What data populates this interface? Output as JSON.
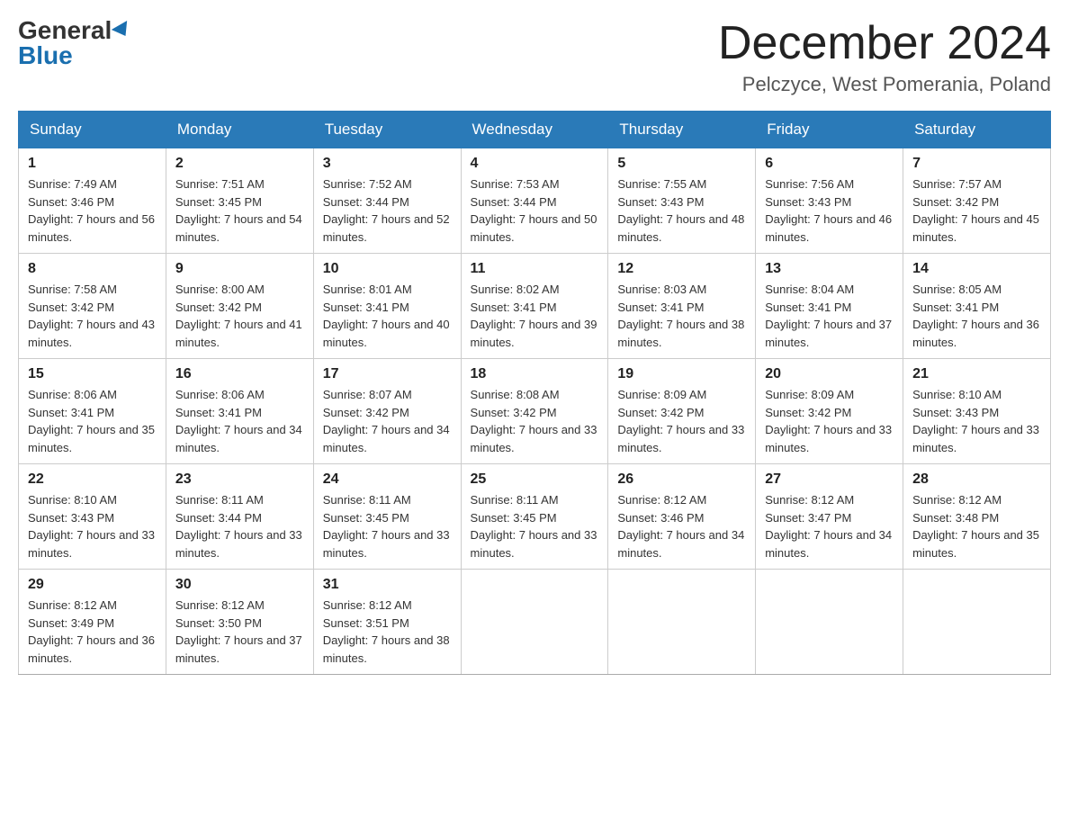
{
  "header": {
    "logo_general": "General",
    "logo_blue": "Blue",
    "month_title": "December 2024",
    "location": "Pelczyce, West Pomerania, Poland"
  },
  "weekdays": [
    "Sunday",
    "Monday",
    "Tuesday",
    "Wednesday",
    "Thursday",
    "Friday",
    "Saturday"
  ],
  "weeks": [
    [
      {
        "day": "1",
        "sunrise": "7:49 AM",
        "sunset": "3:46 PM",
        "daylight": "7 hours and 56 minutes."
      },
      {
        "day": "2",
        "sunrise": "7:51 AM",
        "sunset": "3:45 PM",
        "daylight": "7 hours and 54 minutes."
      },
      {
        "day": "3",
        "sunrise": "7:52 AM",
        "sunset": "3:44 PM",
        "daylight": "7 hours and 52 minutes."
      },
      {
        "day": "4",
        "sunrise": "7:53 AM",
        "sunset": "3:44 PM",
        "daylight": "7 hours and 50 minutes."
      },
      {
        "day": "5",
        "sunrise": "7:55 AM",
        "sunset": "3:43 PM",
        "daylight": "7 hours and 48 minutes."
      },
      {
        "day": "6",
        "sunrise": "7:56 AM",
        "sunset": "3:43 PM",
        "daylight": "7 hours and 46 minutes."
      },
      {
        "day": "7",
        "sunrise": "7:57 AM",
        "sunset": "3:42 PM",
        "daylight": "7 hours and 45 minutes."
      }
    ],
    [
      {
        "day": "8",
        "sunrise": "7:58 AM",
        "sunset": "3:42 PM",
        "daylight": "7 hours and 43 minutes."
      },
      {
        "day": "9",
        "sunrise": "8:00 AM",
        "sunset": "3:42 PM",
        "daylight": "7 hours and 41 minutes."
      },
      {
        "day": "10",
        "sunrise": "8:01 AM",
        "sunset": "3:41 PM",
        "daylight": "7 hours and 40 minutes."
      },
      {
        "day": "11",
        "sunrise": "8:02 AM",
        "sunset": "3:41 PM",
        "daylight": "7 hours and 39 minutes."
      },
      {
        "day": "12",
        "sunrise": "8:03 AM",
        "sunset": "3:41 PM",
        "daylight": "7 hours and 38 minutes."
      },
      {
        "day": "13",
        "sunrise": "8:04 AM",
        "sunset": "3:41 PM",
        "daylight": "7 hours and 37 minutes."
      },
      {
        "day": "14",
        "sunrise": "8:05 AM",
        "sunset": "3:41 PM",
        "daylight": "7 hours and 36 minutes."
      }
    ],
    [
      {
        "day": "15",
        "sunrise": "8:06 AM",
        "sunset": "3:41 PM",
        "daylight": "7 hours and 35 minutes."
      },
      {
        "day": "16",
        "sunrise": "8:06 AM",
        "sunset": "3:41 PM",
        "daylight": "7 hours and 34 minutes."
      },
      {
        "day": "17",
        "sunrise": "8:07 AM",
        "sunset": "3:42 PM",
        "daylight": "7 hours and 34 minutes."
      },
      {
        "day": "18",
        "sunrise": "8:08 AM",
        "sunset": "3:42 PM",
        "daylight": "7 hours and 33 minutes."
      },
      {
        "day": "19",
        "sunrise": "8:09 AM",
        "sunset": "3:42 PM",
        "daylight": "7 hours and 33 minutes."
      },
      {
        "day": "20",
        "sunrise": "8:09 AM",
        "sunset": "3:42 PM",
        "daylight": "7 hours and 33 minutes."
      },
      {
        "day": "21",
        "sunrise": "8:10 AM",
        "sunset": "3:43 PM",
        "daylight": "7 hours and 33 minutes."
      }
    ],
    [
      {
        "day": "22",
        "sunrise": "8:10 AM",
        "sunset": "3:43 PM",
        "daylight": "7 hours and 33 minutes."
      },
      {
        "day": "23",
        "sunrise": "8:11 AM",
        "sunset": "3:44 PM",
        "daylight": "7 hours and 33 minutes."
      },
      {
        "day": "24",
        "sunrise": "8:11 AM",
        "sunset": "3:45 PM",
        "daylight": "7 hours and 33 minutes."
      },
      {
        "day": "25",
        "sunrise": "8:11 AM",
        "sunset": "3:45 PM",
        "daylight": "7 hours and 33 minutes."
      },
      {
        "day": "26",
        "sunrise": "8:12 AM",
        "sunset": "3:46 PM",
        "daylight": "7 hours and 34 minutes."
      },
      {
        "day": "27",
        "sunrise": "8:12 AM",
        "sunset": "3:47 PM",
        "daylight": "7 hours and 34 minutes."
      },
      {
        "day": "28",
        "sunrise": "8:12 AM",
        "sunset": "3:48 PM",
        "daylight": "7 hours and 35 minutes."
      }
    ],
    [
      {
        "day": "29",
        "sunrise": "8:12 AM",
        "sunset": "3:49 PM",
        "daylight": "7 hours and 36 minutes."
      },
      {
        "day": "30",
        "sunrise": "8:12 AM",
        "sunset": "3:50 PM",
        "daylight": "7 hours and 37 minutes."
      },
      {
        "day": "31",
        "sunrise": "8:12 AM",
        "sunset": "3:51 PM",
        "daylight": "7 hours and 38 minutes."
      },
      null,
      null,
      null,
      null
    ]
  ]
}
